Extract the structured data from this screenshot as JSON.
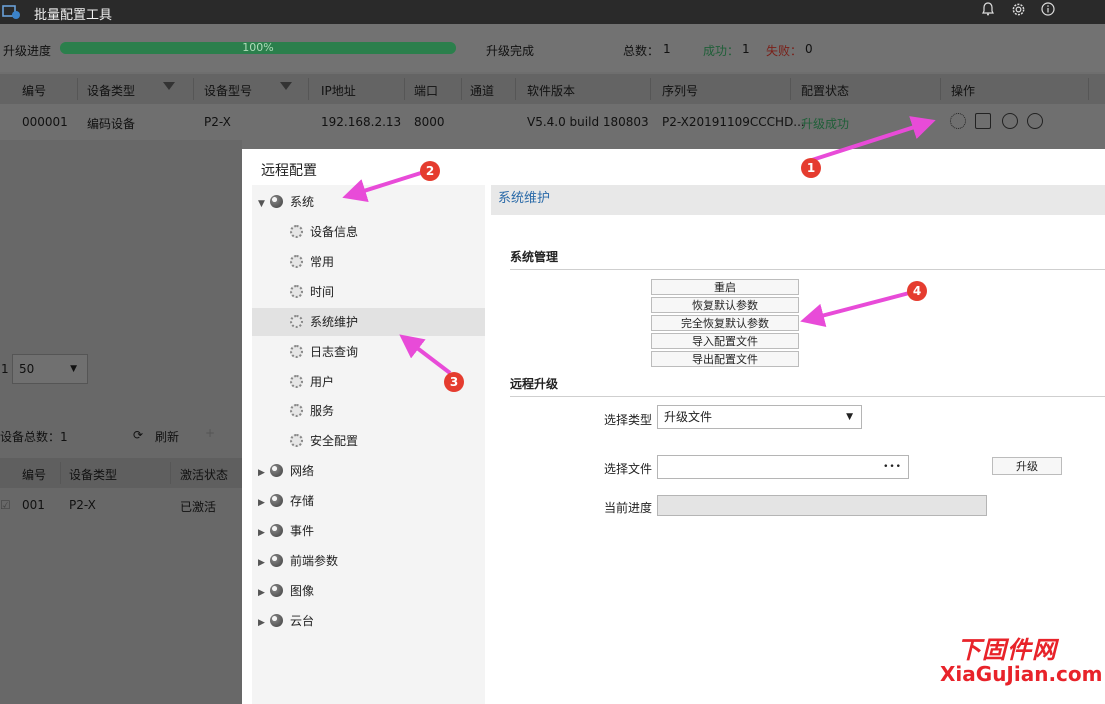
{
  "window": {
    "title": "批量配置工具"
  },
  "progress": {
    "label": "升级进度",
    "percent_text": "100%",
    "percent_value": 1.0,
    "status_text": "升级完成",
    "total_label": "总数：",
    "total_value": "1",
    "success_label": "成功：",
    "success_value": "1",
    "fail_label": "失败：",
    "fail_value": "0"
  },
  "device_table": {
    "headers": [
      "编号",
      "设备类型",
      "设备型号",
      "IP地址",
      "端口",
      "通道",
      "软件版本",
      "序列号",
      "配置状态",
      "操作"
    ],
    "row": {
      "id": "000001",
      "type": "编码设备",
      "model": "P2-X",
      "ip": "192.168.2.13",
      "port": "8000",
      "version": "V5.4.0 build 180803",
      "serial": "P2-X20191109CCCHD...",
      "status": "升级成功"
    }
  },
  "lower_panel": {
    "page_size": "50",
    "page_prefix": "1",
    "device_total": "设备总数：1",
    "refresh": "刷新",
    "headers": [
      "编号",
      "设备类型",
      "激活状态"
    ],
    "row": {
      "id": "001",
      "type": "P2-X",
      "status": "已激活"
    }
  },
  "dialog": {
    "title": "远程配置",
    "tree": {
      "system": "系统",
      "children": [
        "设备信息",
        "常用",
        "时间",
        "系统维护",
        "日志查询",
        "用户",
        "服务",
        "安全配置"
      ],
      "others": [
        "网络",
        "存储",
        "事件",
        "前端参数",
        "图像",
        "云台"
      ]
    },
    "section_title": "系统维护",
    "sys_mgmt": {
      "heading": "系统管理",
      "buttons": [
        "重启",
        "恢复默认参数",
        "完全恢复默认参数",
        "导入配置文件",
        "导出配置文件"
      ]
    },
    "remote_upgrade": {
      "heading": "远程升级",
      "type_label": "选择类型",
      "type_value": "升级文件",
      "file_label": "选择文件",
      "file_dots": "•••",
      "upgrade_button": "升级",
      "progress_label": "当前进度"
    }
  },
  "annotations": {
    "badges": [
      "1",
      "2",
      "3",
      "4"
    ]
  },
  "watermark": {
    "cn": "下固件网",
    "en": "XiaGuJian.com"
  },
  "colors": {
    "accent": "#2a6aa8",
    "success": "#2b7f4c",
    "fail": "#c0392b",
    "arrow": "#e84bd8",
    "badge": "#e53c2f"
  }
}
